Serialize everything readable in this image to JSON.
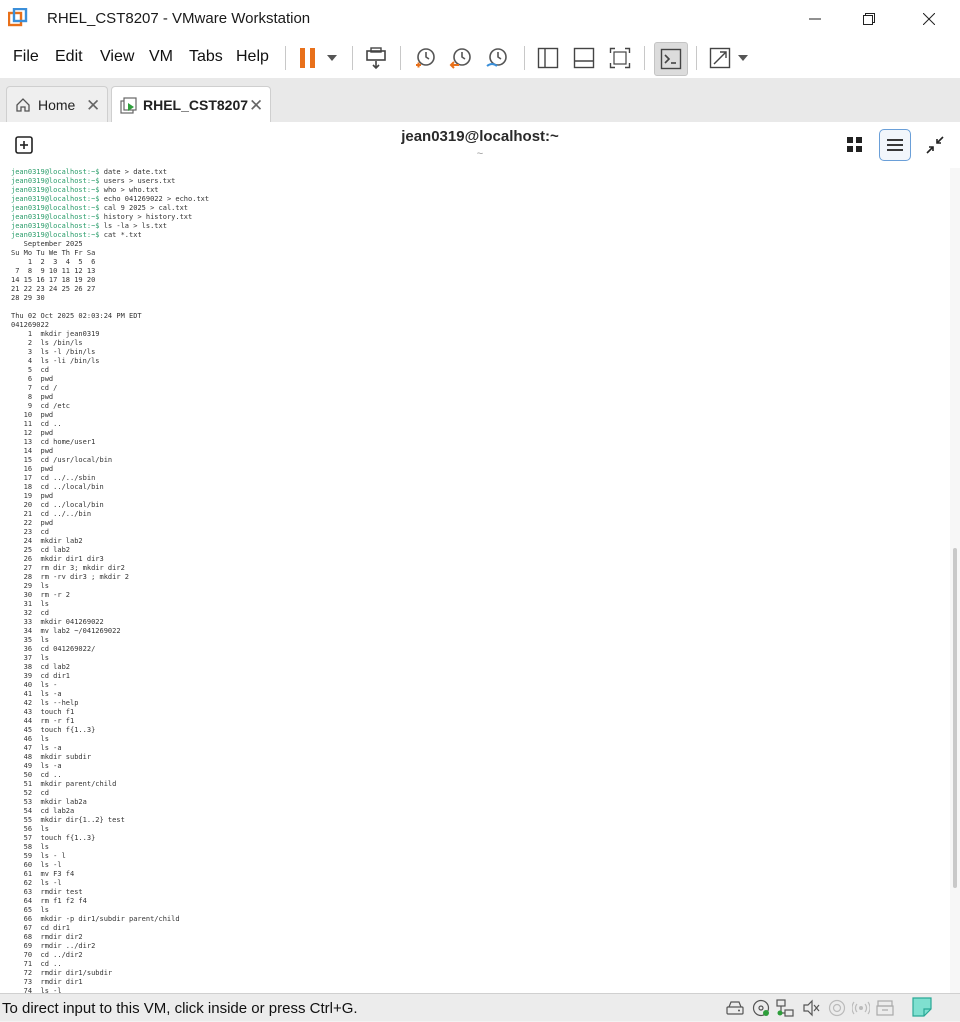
{
  "window": {
    "title": "RHEL_CST8207 - VMware Workstation",
    "icon": "vmware-logo-icon"
  },
  "menu": {
    "items": [
      "File",
      "Edit",
      "View",
      "VM",
      "Tabs",
      "Help"
    ]
  },
  "toolbar": {
    "icons": [
      "pause-icon",
      "dropdown-arrow-icon",
      "send-ctrl-alt-del-icon",
      "snapshot-icon",
      "revert-snapshot-icon",
      "snapshot-manager-icon",
      "show-library-icon",
      "thumbnail-bar-icon",
      "full-screen-icon",
      "console-view-icon",
      "stretch-icon",
      "dropdown-arrow-icon"
    ]
  },
  "tabs": [
    {
      "label": "Home",
      "icon": "home-icon",
      "active": false
    },
    {
      "label": "RHEL_CST8207",
      "icon": "vm-running-icon",
      "active": true
    }
  ],
  "vm_header": {
    "title": "jean0319@localhost:~",
    "subtitle": "~"
  },
  "terminal": {
    "prompt": "jean0319@localhost:~$",
    "commands": [
      "date > date.txt",
      "users > users.txt",
      "who > who.txt",
      "echo 041269022 > echo.txt",
      "cal 9 2025 > cal.txt",
      "history > history.txt",
      "ls -la > ls.txt",
      "cat *.txt"
    ],
    "output": [
      "   September 2025",
      "Su Mo Tu We Th Fr Sa",
      "    1  2  3  4  5  6",
      " 7  8  9 10 11 12 13",
      "14 15 16 17 18 19 20",
      "21 22 23 24 25 26 27",
      "28 29 30",
      "",
      "Thu 02 Oct 2025 02:03:24 PM EDT",
      "041269022",
      "    1  mkdir jean0319",
      "    2  ls /bin/ls",
      "    3  ls -l /bin/ls",
      "    4  ls -li /bin/ls",
      "    5  cd",
      "    6  pwd",
      "    7  cd /",
      "    8  pwd",
      "    9  cd /etc",
      "   10  pwd",
      "   11  cd ..",
      "   12  pwd",
      "   13  cd home/user1",
      "   14  pwd",
      "   15  cd /usr/local/bin",
      "   16  pwd",
      "   17  cd ../../sbin",
      "   18  cd ../local/bin",
      "   19  pwd",
      "   20  cd ../local/bin",
      "   21  cd ../../bin",
      "   22  pwd",
      "   23  cd",
      "   24  mkdir lab2",
      "   25  cd lab2",
      "   26  mkdir dir1 dir3",
      "   27  rm dir 3; mkdir dir2",
      "   28  rm -rv dir3 ; mkdir 2",
      "   29  ls",
      "   30  rm -r 2",
      "   31  ls",
      "   32  cd",
      "   33  mkdir 041269022",
      "   34  mv lab2 ~/041269022",
      "   35  ls",
      "   36  cd 041269022/",
      "   37  ls",
      "   38  cd lab2",
      "   39  cd dir1",
      "   40  ls -",
      "   41  ls -a",
      "   42  ls --help",
      "   43  touch f1",
      "   44  rm -r f1",
      "   45  touch f{1..3}",
      "   46  ls",
      "   47  ls -a",
      "   48  mkdir subdir",
      "   49  ls -a",
      "   50  cd ..",
      "   51  mkdir parent/child",
      "   52  cd",
      "   53  mkdir lab2a",
      "   54  cd lab2a",
      "   55  mkdir dir{1..2} test",
      "   56  ls",
      "   57  touch f{1..3}",
      "   58  ls",
      "   59  ls - l",
      "   60  ls -l",
      "   61  mv F3 f4",
      "   62  ls -l",
      "   63  rmdir test",
      "   64  rm f1 f2 f4",
      "   65  ls",
      "   66  mkdir -p dir1/subdir parent/child",
      "   67  cd dir1",
      "   68  rmdir dir2",
      "   69  rmdir ../dir2",
      "   70  cd ../dir2",
      "   71  cd ..",
      "   72  rmdir dir1/subdir",
      "   73  rmdir dir1",
      "   74  ls -l"
    ]
  },
  "statusbar": {
    "message": "To direct input to this VM, click inside or press Ctrl+G.",
    "icons": [
      "hard-disk-icon",
      "cd-dvd-icon",
      "network-adapter-icon",
      "sound-card-icon",
      "usb-icon",
      "bluetooth-icon",
      "printer-icon",
      "message-log-icon"
    ]
  },
  "colors": {
    "accent": "#1f6fc5",
    "pause": "#e8701a",
    "prompt": "#2a9d6a"
  }
}
